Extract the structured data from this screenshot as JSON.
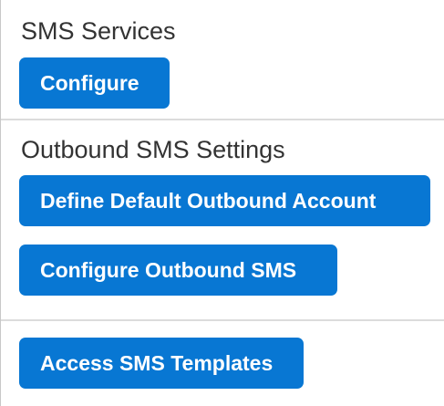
{
  "sms_services": {
    "heading": "SMS Services",
    "configure_label": "Configure"
  },
  "outbound_sms_settings": {
    "heading": "Outbound SMS Settings",
    "define_default_label": "Define Default Outbound Account",
    "configure_outbound_label": "Configure Outbound SMS"
  },
  "templates": {
    "access_templates_label": "Access SMS Templates"
  },
  "colors": {
    "button_background": "#0877d3",
    "button_text": "#ffffff",
    "heading_text": "#333333",
    "divider": "#dcdcdc"
  }
}
